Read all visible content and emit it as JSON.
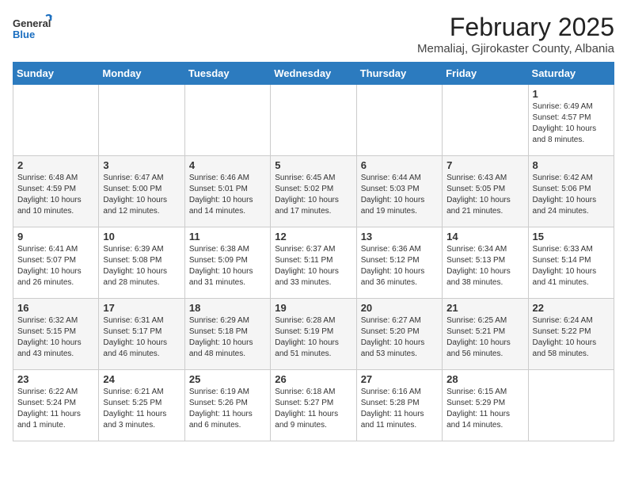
{
  "header": {
    "logo_general": "General",
    "logo_blue": "Blue",
    "title": "February 2025",
    "subtitle": "Memaliaj, Gjirokaster County, Albania"
  },
  "days_of_week": [
    "Sunday",
    "Monday",
    "Tuesday",
    "Wednesday",
    "Thursday",
    "Friday",
    "Saturday"
  ],
  "weeks": [
    {
      "days": [
        {
          "num": "",
          "info": ""
        },
        {
          "num": "",
          "info": ""
        },
        {
          "num": "",
          "info": ""
        },
        {
          "num": "",
          "info": ""
        },
        {
          "num": "",
          "info": ""
        },
        {
          "num": "",
          "info": ""
        },
        {
          "num": "1",
          "info": "Sunrise: 6:49 AM\nSunset: 4:57 PM\nDaylight: 10 hours and 8 minutes."
        }
      ]
    },
    {
      "days": [
        {
          "num": "2",
          "info": "Sunrise: 6:48 AM\nSunset: 4:59 PM\nDaylight: 10 hours and 10 minutes."
        },
        {
          "num": "3",
          "info": "Sunrise: 6:47 AM\nSunset: 5:00 PM\nDaylight: 10 hours and 12 minutes."
        },
        {
          "num": "4",
          "info": "Sunrise: 6:46 AM\nSunset: 5:01 PM\nDaylight: 10 hours and 14 minutes."
        },
        {
          "num": "5",
          "info": "Sunrise: 6:45 AM\nSunset: 5:02 PM\nDaylight: 10 hours and 17 minutes."
        },
        {
          "num": "6",
          "info": "Sunrise: 6:44 AM\nSunset: 5:03 PM\nDaylight: 10 hours and 19 minutes."
        },
        {
          "num": "7",
          "info": "Sunrise: 6:43 AM\nSunset: 5:05 PM\nDaylight: 10 hours and 21 minutes."
        },
        {
          "num": "8",
          "info": "Sunrise: 6:42 AM\nSunset: 5:06 PM\nDaylight: 10 hours and 24 minutes."
        }
      ]
    },
    {
      "days": [
        {
          "num": "9",
          "info": "Sunrise: 6:41 AM\nSunset: 5:07 PM\nDaylight: 10 hours and 26 minutes."
        },
        {
          "num": "10",
          "info": "Sunrise: 6:39 AM\nSunset: 5:08 PM\nDaylight: 10 hours and 28 minutes."
        },
        {
          "num": "11",
          "info": "Sunrise: 6:38 AM\nSunset: 5:09 PM\nDaylight: 10 hours and 31 minutes."
        },
        {
          "num": "12",
          "info": "Sunrise: 6:37 AM\nSunset: 5:11 PM\nDaylight: 10 hours and 33 minutes."
        },
        {
          "num": "13",
          "info": "Sunrise: 6:36 AM\nSunset: 5:12 PM\nDaylight: 10 hours and 36 minutes."
        },
        {
          "num": "14",
          "info": "Sunrise: 6:34 AM\nSunset: 5:13 PM\nDaylight: 10 hours and 38 minutes."
        },
        {
          "num": "15",
          "info": "Sunrise: 6:33 AM\nSunset: 5:14 PM\nDaylight: 10 hours and 41 minutes."
        }
      ]
    },
    {
      "days": [
        {
          "num": "16",
          "info": "Sunrise: 6:32 AM\nSunset: 5:15 PM\nDaylight: 10 hours and 43 minutes."
        },
        {
          "num": "17",
          "info": "Sunrise: 6:31 AM\nSunset: 5:17 PM\nDaylight: 10 hours and 46 minutes."
        },
        {
          "num": "18",
          "info": "Sunrise: 6:29 AM\nSunset: 5:18 PM\nDaylight: 10 hours and 48 minutes."
        },
        {
          "num": "19",
          "info": "Sunrise: 6:28 AM\nSunset: 5:19 PM\nDaylight: 10 hours and 51 minutes."
        },
        {
          "num": "20",
          "info": "Sunrise: 6:27 AM\nSunset: 5:20 PM\nDaylight: 10 hours and 53 minutes."
        },
        {
          "num": "21",
          "info": "Sunrise: 6:25 AM\nSunset: 5:21 PM\nDaylight: 10 hours and 56 minutes."
        },
        {
          "num": "22",
          "info": "Sunrise: 6:24 AM\nSunset: 5:22 PM\nDaylight: 10 hours and 58 minutes."
        }
      ]
    },
    {
      "days": [
        {
          "num": "23",
          "info": "Sunrise: 6:22 AM\nSunset: 5:24 PM\nDaylight: 11 hours and 1 minute."
        },
        {
          "num": "24",
          "info": "Sunrise: 6:21 AM\nSunset: 5:25 PM\nDaylight: 11 hours and 3 minutes."
        },
        {
          "num": "25",
          "info": "Sunrise: 6:19 AM\nSunset: 5:26 PM\nDaylight: 11 hours and 6 minutes."
        },
        {
          "num": "26",
          "info": "Sunrise: 6:18 AM\nSunset: 5:27 PM\nDaylight: 11 hours and 9 minutes."
        },
        {
          "num": "27",
          "info": "Sunrise: 6:16 AM\nSunset: 5:28 PM\nDaylight: 11 hours and 11 minutes."
        },
        {
          "num": "28",
          "info": "Sunrise: 6:15 AM\nSunset: 5:29 PM\nDaylight: 11 hours and 14 minutes."
        },
        {
          "num": "",
          "info": ""
        }
      ]
    }
  ]
}
